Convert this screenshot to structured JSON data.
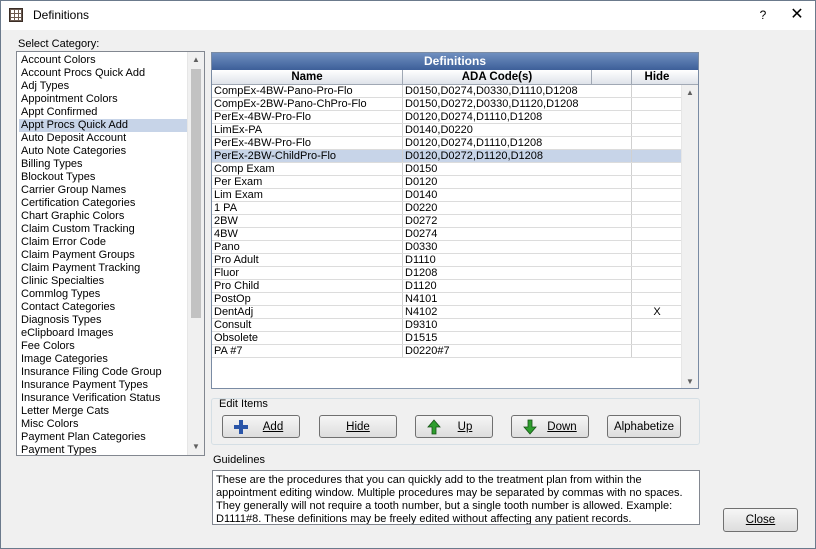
{
  "window": {
    "title": "Definitions",
    "help": "?",
    "close": "✕"
  },
  "category": {
    "label": "Select Category:",
    "items": [
      "Account Colors",
      "Account Procs Quick Add",
      "Adj Types",
      "Appointment Colors",
      "Appt Confirmed",
      "Appt Procs Quick Add",
      "Auto Deposit Account",
      "Auto Note Categories",
      "Billing Types",
      "Blockout Types",
      "Carrier Group Names",
      "Certification Categories",
      "Chart Graphic Colors",
      "Claim Custom Tracking",
      "Claim Error Code",
      "Claim Payment Groups",
      "Claim Payment Tracking",
      "Clinic Specialties",
      "Commlog Types",
      "Contact Categories",
      "Diagnosis Types",
      "eClipboard Images",
      "Fee Colors",
      "Image Categories",
      "Insurance Filing Code Group",
      "Insurance Payment Types",
      "Insurance Verification Status",
      "Letter Merge Cats",
      "Misc Colors",
      "Payment Plan Categories",
      "Payment Types"
    ],
    "selected_index": 5
  },
  "definitions": {
    "title": "Definitions",
    "columns": {
      "name": "Name",
      "code": "ADA Code(s)",
      "hide": "Hide"
    },
    "rows": [
      {
        "name": "CompEx-4BW-Pano-Pro-Flo",
        "code": "D0150,D0274,D0330,D1110,D1208",
        "hide": ""
      },
      {
        "name": "CompEx-2BW-Pano-ChPro-Flo",
        "code": "D0150,D0272,D0330,D1120,D1208",
        "hide": ""
      },
      {
        "name": "PerEx-4BW-Pro-Flo",
        "code": "D0120,D0274,D1110,D1208",
        "hide": ""
      },
      {
        "name": "LimEx-PA",
        "code": "D0140,D0220",
        "hide": ""
      },
      {
        "name": "PerEx-4BW-Pro-Flo",
        "code": "D0120,D0274,D1110,D1208",
        "hide": ""
      },
      {
        "name": "PerEx-2BW-ChildPro-Flo",
        "code": "D0120,D0272,D1120,D1208",
        "hide": ""
      },
      {
        "name": "Comp Exam",
        "code": "D0150",
        "hide": ""
      },
      {
        "name": "Per Exam",
        "code": "D0120",
        "hide": ""
      },
      {
        "name": "Lim Exam",
        "code": "D0140",
        "hide": ""
      },
      {
        "name": "1 PA",
        "code": "D0220",
        "hide": ""
      },
      {
        "name": "2BW",
        "code": "D0272",
        "hide": ""
      },
      {
        "name": "4BW",
        "code": "D0274",
        "hide": ""
      },
      {
        "name": "Pano",
        "code": "D0330",
        "hide": ""
      },
      {
        "name": "Pro Adult",
        "code": "D1110",
        "hide": ""
      },
      {
        "name": "Fluor",
        "code": "D1208",
        "hide": ""
      },
      {
        "name": "Pro Child",
        "code": "D1120",
        "hide": ""
      },
      {
        "name": "PostOp",
        "code": "N4101",
        "hide": ""
      },
      {
        "name": "DentAdj",
        "code": "N4102",
        "hide": "X"
      },
      {
        "name": "Consult",
        "code": "D9310",
        "hide": ""
      },
      {
        "name": "Obsolete",
        "code": "D1515",
        "hide": ""
      },
      {
        "name": "PA #7",
        "code": "D0220#7",
        "hide": ""
      }
    ],
    "selected_index": 5
  },
  "edit_items": {
    "label": "Edit Items",
    "add": "Add",
    "hide": "Hide",
    "up": "Up",
    "down": "Down",
    "alphabetize": "Alphabetize"
  },
  "guidelines": {
    "label": "Guidelines",
    "text": "These are the procedures that you can quickly add to the treatment plan from within the appointment editing window. Multiple procedures may be separated by commas with no spaces. They generally will not require a tooth number, but a single tooth number is allowed. Example: D1111#8. These definitions may be freely edited without affecting any patient records."
  },
  "close_button": "Close",
  "colors": {
    "selection": "#c7d4e8",
    "grid_title": "#3d5f99",
    "up_arrow": "#2e9e2e",
    "add_cross": "#2a55a8"
  },
  "icons": {
    "add": "plus-icon",
    "up": "arrow-up-icon",
    "down": "arrow-down-icon"
  }
}
